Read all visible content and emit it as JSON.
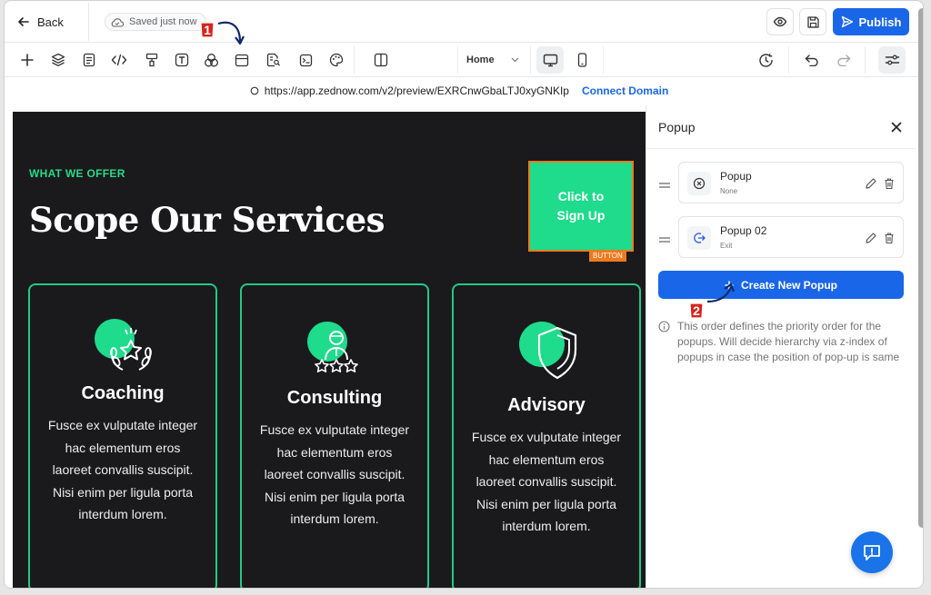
{
  "topbar": {
    "back_label": "Back",
    "saved_label": "Saved just now",
    "publish_label": "Publish"
  },
  "toolbar": {
    "page_select": "Home"
  },
  "url": {
    "address": "https://app.zednow.com/v2/preview/EXRCnwGbaLTJ0xyGNKIp",
    "connect_label": "Connect Domain"
  },
  "canvas": {
    "eyebrow": "WHAT WE OFFER",
    "headline": "Scope Our Services",
    "cta_label": "Click to Sign Up",
    "cta_tag": "BUTTON",
    "cards": [
      {
        "title": "Coaching",
        "body": "Fusce ex vulputate integer hac elementum eros laoreet convallis suscipit. Nisi enim per ligula porta interdum lorem."
      },
      {
        "title": "Consulting",
        "body": "Fusce ex vulputate integer hac elementum eros laoreet convallis suscipit. Nisi enim per ligula porta interdum lorem."
      },
      {
        "title": "Advisory",
        "body": "Fusce ex vulputate integer hac elementum eros laoreet convallis suscipit. Nisi enim per ligula porta interdum lorem."
      }
    ]
  },
  "panel": {
    "title": "Popup",
    "popups": [
      {
        "name": "Popup",
        "sub": "None"
      },
      {
        "name": "Popup 02",
        "sub": "Exit"
      }
    ],
    "create_label": "Create New Popup",
    "note": "This order defines the priority order for the popups. Will decide hierarchy via z-index of popups in case the position of pop-up is same"
  },
  "annotations": {
    "badge1": "1",
    "badge2": "2"
  },
  "colors": {
    "accent": "#1a66e8",
    "green": "#1fdb8c",
    "canvas_bg": "#1a1a1c",
    "selection": "#ee7a1f",
    "badge": "#d6241d"
  }
}
